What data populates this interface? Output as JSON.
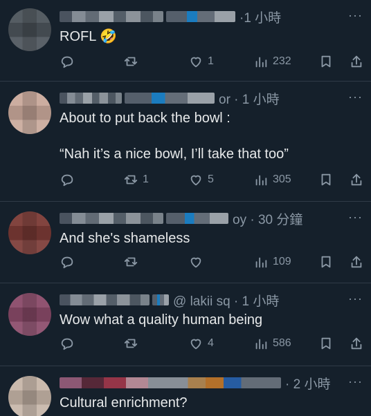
{
  "colors": {
    "background": "#15202b",
    "text": "#e7e9ea",
    "muted": "#8b98a5",
    "divider": "#2f3b47",
    "verified_blue": "#1d9bf0"
  },
  "icons": {
    "more": "more-icon",
    "reply": "reply-icon",
    "retweet": "retweet-icon",
    "like": "heart-icon",
    "views": "views-icon",
    "bookmark": "bookmark-icon",
    "share": "share-icon"
  },
  "tweets": [
    {
      "meta": "·1 小時",
      "text": "ROFL 🤣",
      "replies": "",
      "retweets": "",
      "likes": "1",
      "views": "232"
    },
    {
      "meta": "or · 1 小時",
      "text": "About to put back the bowl :\n\n“Nah it’s a nice bowl, I’ll take that too”",
      "replies": "",
      "retweets": "1",
      "likes": "5",
      "views": "305"
    },
    {
      "meta": "oy · 30 分鐘",
      "text": "And she's shameless",
      "replies": "",
      "retweets": "",
      "likes": "",
      "views": "109"
    },
    {
      "meta": "@ lakii sq · 1 小時",
      "text": "Wow what a quality human being",
      "replies": "",
      "retweets": "",
      "likes": "4",
      "views": "586"
    },
    {
      "meta": "· 2 小時",
      "text": "Cultural enrichment?",
      "replies": "",
      "retweets": "",
      "likes": "",
      "views": ""
    }
  ],
  "more_label": "···"
}
